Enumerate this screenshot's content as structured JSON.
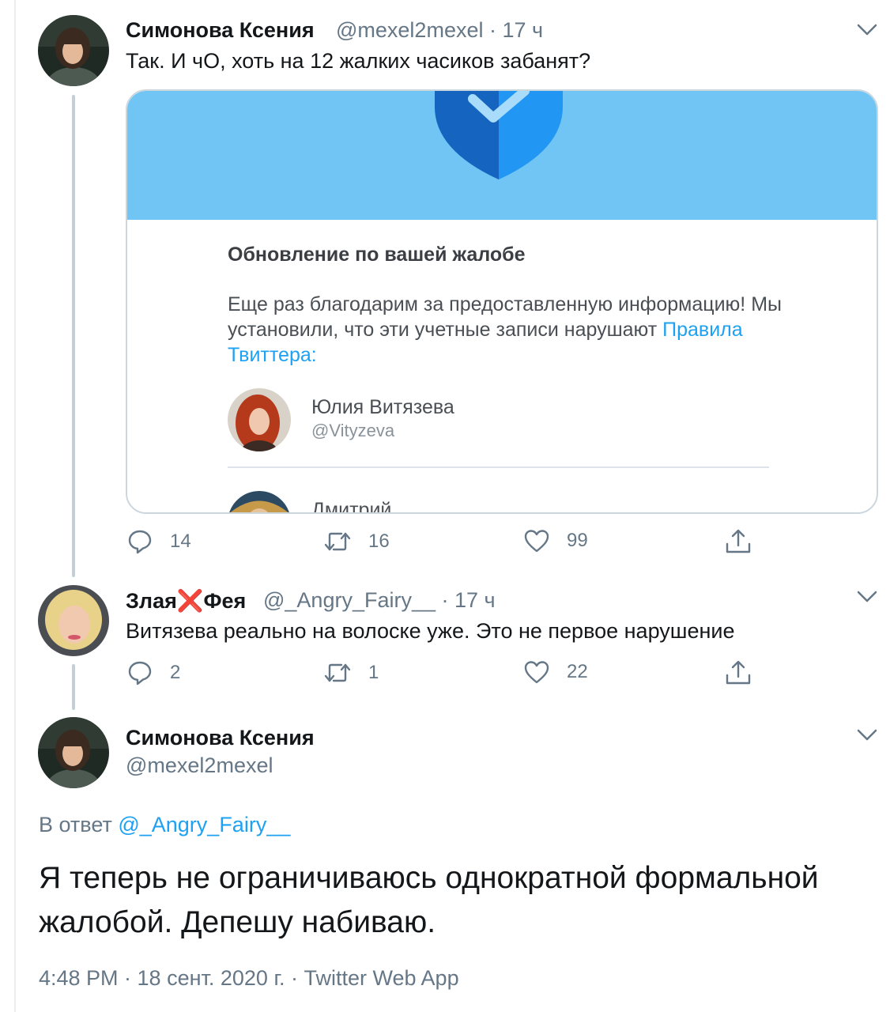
{
  "tweet1": {
    "author_name": "Симонова Ксения",
    "handle_time": "@mexel2mexel · 17 ч",
    "text": "Так. И чО, хоть на 12 жалких часиков забанят?",
    "card": {
      "title": "Обновление по вашей жалобе",
      "body_before_link": "Еще раз благодарим за предоставленную информацию! Мы установили, что эти учетные записи нарушают ",
      "link": "Правила Твиттера",
      "body_after_link": ":",
      "accounts": [
        {
          "name": "Юлия Витязева",
          "handle": "@Vityzeva"
        },
        {
          "name": "Дмитрий"
        }
      ]
    },
    "actions": {
      "replies": "14",
      "retweets": "16",
      "likes": "99"
    }
  },
  "tweet2": {
    "author_name_part1": "Злая",
    "author_emoji": "❌",
    "author_name_part2": "Фея",
    "handle_time": "@_Angry_Fairy__ · 17 ч",
    "text": "Витязева реально на волоске уже. Это не первое нарушение",
    "actions": {
      "replies": "2",
      "retweets": "1",
      "likes": "22"
    }
  },
  "main_tweet": {
    "author_name": "Симонова Ксения",
    "handle": "@mexel2mexel",
    "reply_prefix": "В ответ",
    "reply_handle": "@_Angry_Fairy__",
    "text": "Я  теперь не ограничиваюсь однократной формальной жалобой. Депешу набиваю.",
    "meta": "4:48 PM · 18 сент. 2020 г. · Twitter Web App"
  },
  "colors": {
    "accent": "#1da1f2",
    "secondary_text": "#657786",
    "thread_line": "#c4cfd6",
    "card_banner": "#71c5f5"
  },
  "icons": [
    "reply-icon",
    "retweet-icon",
    "like-icon",
    "share-icon",
    "chevron-down-icon",
    "shield-check-icon"
  ]
}
